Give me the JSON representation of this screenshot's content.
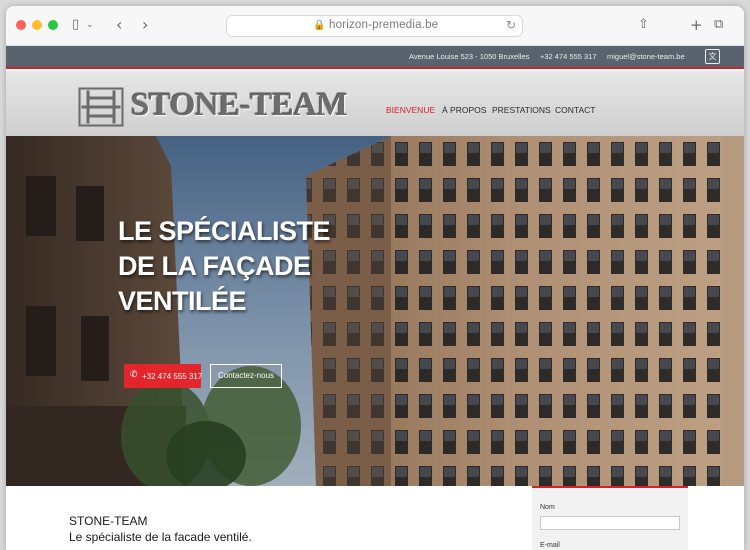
{
  "browser": {
    "url": "horizon-premedia.be"
  },
  "topbar": {
    "address": "Avenue Louise 523 - 1050 Bruxelles",
    "phone": "+32 474 555 317",
    "email": "miguel@stone-team.be"
  },
  "header": {
    "logo_text": "STONE-TEAM",
    "nav": [
      {
        "label": "BIENVENUE",
        "active": true
      },
      {
        "label": "À PROPOS",
        "active": false
      },
      {
        "label": "PRESTATIONS",
        "active": false
      },
      {
        "label": "CONTACT",
        "active": false
      }
    ]
  },
  "hero": {
    "title_lines": [
      "LE SPÉCIALISTE",
      "DE LA FAÇADE",
      "VENTILÉE"
    ],
    "phone_button": "+32 474 555 317",
    "contact_button": "Contactez-nous"
  },
  "content": {
    "heading": "STONE-TEAM",
    "subheading": "Le spécialiste de la facade ventilé."
  },
  "form": {
    "name_label": "Nom",
    "email_label": "E-mail"
  },
  "colors": {
    "accent": "#d2232a",
    "topbar": "#58636d"
  }
}
